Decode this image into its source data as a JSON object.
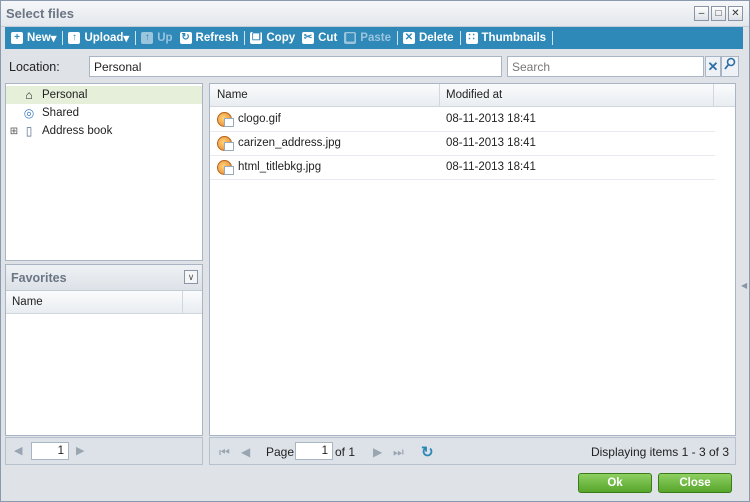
{
  "window": {
    "title": "Select files",
    "controls": [
      "minimize-icon",
      "maximize-icon",
      "close-icon"
    ]
  },
  "toolbar": {
    "new_label": "New",
    "upload_label": "Upload",
    "up_label": "Up",
    "refresh_label": "Refresh",
    "copy_label": "Copy",
    "cut_label": "Cut",
    "paste_label": "Paste",
    "delete_label": "Delete",
    "thumbnails_label": "Thumbnails"
  },
  "location": {
    "label": "Location:",
    "value": "Personal",
    "search_placeholder": "Search"
  },
  "tree": {
    "items": [
      {
        "label": "Personal",
        "icon": "home-icon",
        "selected": true
      },
      {
        "label": "Shared",
        "icon": "globe-icon",
        "selected": false
      },
      {
        "label": "Address book",
        "icon": "address-book-icon",
        "selected": false
      }
    ]
  },
  "favorites": {
    "title": "Favorites",
    "column_name": "Name",
    "pager_value": "1"
  },
  "files": {
    "columns": {
      "name": "Name",
      "modified": "Modified at"
    },
    "rows": [
      {
        "name": "clogo.gif",
        "modified": "08-11-2013 18:41"
      },
      {
        "name": "carizen_address.jpg",
        "modified": "08-11-2013 18:41"
      },
      {
        "name": "html_titlebkg.jpg",
        "modified": "08-11-2013 18:41"
      }
    ]
  },
  "pager": {
    "page_label": "Page",
    "page_value": "1",
    "of_label": "of 1",
    "display_text": "Displaying items 1 - 3 of 3"
  },
  "buttons": {
    "ok": "Ok",
    "close": "Close"
  },
  "colors": {
    "toolbar": "#2f89b8",
    "button_green": "#57a52b",
    "selected_row": "#e6efd9"
  }
}
